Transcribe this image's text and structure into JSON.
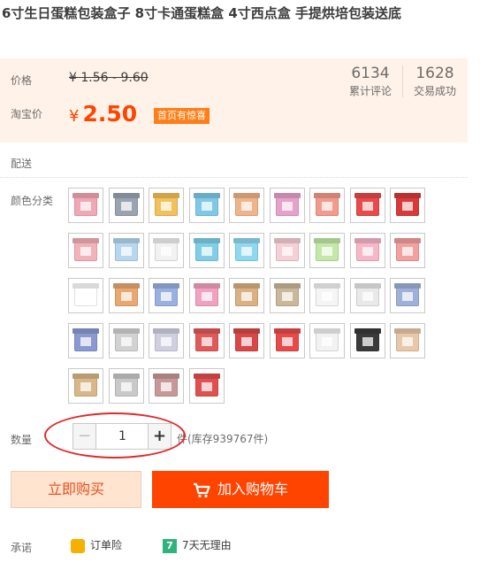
{
  "product": {
    "title": "6寸生日蛋糕包装盒子 8寸卡通蛋糕盒 4寸西点盒 手提烘培包装送底"
  },
  "price": {
    "label": "价格",
    "original": "¥ 1.56 - 9.60",
    "taobao_label": "淘宝价",
    "currency": "¥",
    "current": "2.50",
    "promo": "首页有惊喜"
  },
  "stats": {
    "reviews_count": "6134",
    "reviews_label": "累计评论",
    "sales_count": "1628",
    "sales_label": "交易成功"
  },
  "delivery": {
    "label": "配送"
  },
  "colors": {
    "label": "颜色分类",
    "swatches": [
      "#f2a7b5",
      "#9aa3b0",
      "#f3c15a",
      "#7fc9e8",
      "#f1b38a",
      "#e8a1c9",
      "#f39a8c",
      "#e94a4a",
      "#d83a3a",
      "#f3b2b8",
      "#b7d7f0",
      "#f2f2f2",
      "#7fd0e6",
      "#8fd8f2",
      "#f6d0d6",
      "#c5e8a8",
      "#f7b7c9",
      "#f2a0a0",
      "#ffffff",
      "#e8a870",
      "#9ab0e0",
      "#f2a2c0",
      "#d9b184",
      "#c9b89a",
      "#f5f5f5",
      "#e9e9e9",
      "#a0b0d8",
      "#8a9ad0",
      "#d2d2d2",
      "#cfcfe0",
      "#e05a5a",
      "#d94848",
      "#e84a4a",
      "#f2f2f2",
      "#3a3a3a",
      "#e8c8a8",
      "#d8b888",
      "#c9c9c9",
      "#c89898",
      "#e05050"
    ]
  },
  "quantity": {
    "label": "数量",
    "minus": "−",
    "value": "1",
    "plus": "+",
    "stock_text": "件(库存939767件)"
  },
  "actions": {
    "buy_now": "立即购买",
    "add_to_cart": "加入购物车"
  },
  "promises": {
    "label": "承诺",
    "insurance": "订单险",
    "seven_icon": "7",
    "no_reason_return": "7天无理由"
  },
  "colors_theme": {
    "accent": "#ff4400",
    "price_bg": "#fff2e8"
  },
  "icons": {
    "cart": "shopping-cart-icon",
    "insurance": "insurance-icon",
    "seven_day": "seven-day-return-icon"
  }
}
